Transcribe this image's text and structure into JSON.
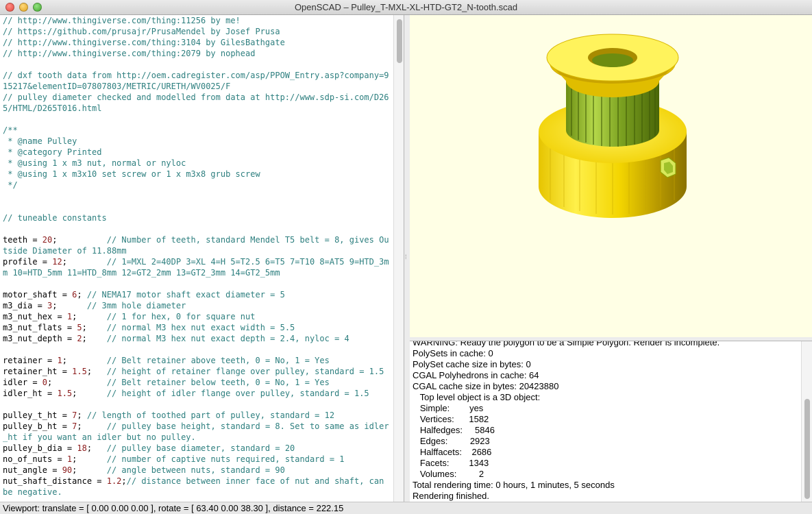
{
  "window": {
    "title": "OpenSCAD – Pulley_T-MXL-XL-HTD-GT2_N-tooth.scad",
    "controls": [
      "close-icon",
      "minimize-icon",
      "zoom-icon"
    ]
  },
  "editor": {
    "lines": [
      [
        [
          "c",
          "// http://www.thingiverse.com/thing:11256 by me!"
        ]
      ],
      [
        [
          "c",
          "// https://github.com/prusajr/PrusaMendel by Josef Prusa"
        ]
      ],
      [
        [
          "c",
          "// http://www.thingiverse.com/thing:3104 by GilesBathgate"
        ]
      ],
      [
        [
          "c",
          "// http://www.thingiverse.com/thing:2079 by nophead"
        ]
      ],
      [],
      [
        [
          "c",
          "// dxf tooth data from http://oem.cadregister.com/asp/PPOW_Entry.asp?company=9"
        ]
      ],
      [
        [
          "c",
          "15217&elementID=07807803/METRIC/URETH/WV0025/F"
        ]
      ],
      [
        [
          "c",
          "// pulley diameter checked and modelled from data at http://www.sdp-si.com/D26"
        ]
      ],
      [
        [
          "c",
          "5/HTML/D265T016.html"
        ]
      ],
      [],
      [
        [
          "c",
          "/**"
        ]
      ],
      [
        [
          "c",
          " * @name Pulley"
        ]
      ],
      [
        [
          "c",
          " * @category Printed"
        ]
      ],
      [
        [
          "c",
          " * @using 1 x m3 nut, normal or nyloc"
        ]
      ],
      [
        [
          "c",
          " * @using 1 x m3x10 set screw or 1 x m3x8 grub screw"
        ]
      ],
      [
        [
          "c",
          " */"
        ]
      ],
      [],
      [],
      [
        [
          "c",
          "// tuneable constants"
        ]
      ],
      [],
      [
        [
          "t",
          "teeth = "
        ],
        [
          "n",
          "20"
        ],
        [
          "t",
          ";          "
        ],
        [
          "c",
          "// Number of teeth, standard Mendel T5 belt = 8, gives Ou"
        ]
      ],
      [
        [
          "c",
          "tside Diameter of 11.88mm"
        ]
      ],
      [
        [
          "t",
          "profile = "
        ],
        [
          "n",
          "12"
        ],
        [
          "t",
          ";        "
        ],
        [
          "c",
          "// 1=MXL 2=40DP 3=XL 4=H 5=T2.5 6=T5 7=T10 8=AT5 9=HTD_3m"
        ]
      ],
      [
        [
          "c",
          "m 10=HTD_5mm 11=HTD_8mm 12=GT2_2mm 13=GT2_3mm 14=GT2_5mm"
        ]
      ],
      [],
      [
        [
          "t",
          "motor_shaft = "
        ],
        [
          "n",
          "6"
        ],
        [
          "t",
          "; "
        ],
        [
          "c",
          "// NEMA17 motor shaft exact diameter = 5"
        ]
      ],
      [
        [
          "t",
          "m3_dia = "
        ],
        [
          "n",
          "3"
        ],
        [
          "t",
          ";      "
        ],
        [
          "c",
          "// 3mm hole diameter"
        ]
      ],
      [
        [
          "t",
          "m3_nut_hex = "
        ],
        [
          "n",
          "1"
        ],
        [
          "t",
          ";      "
        ],
        [
          "c",
          "// 1 for hex, 0 for square nut"
        ]
      ],
      [
        [
          "t",
          "m3_nut_flats = "
        ],
        [
          "n",
          "5"
        ],
        [
          "t",
          ";    "
        ],
        [
          "c",
          "// normal M3 hex nut exact width = 5.5"
        ]
      ],
      [
        [
          "t",
          "m3_nut_depth = "
        ],
        [
          "n",
          "2"
        ],
        [
          "t",
          ";    "
        ],
        [
          "c",
          "// normal M3 hex nut exact depth = 2.4, nyloc = 4"
        ]
      ],
      [],
      [
        [
          "t",
          "retainer = "
        ],
        [
          "n",
          "1"
        ],
        [
          "t",
          ";        "
        ],
        [
          "c",
          "// Belt retainer above teeth, 0 = No, 1 = Yes"
        ]
      ],
      [
        [
          "t",
          "retainer_ht = "
        ],
        [
          "n",
          "1.5"
        ],
        [
          "t",
          ";   "
        ],
        [
          "c",
          "// height of retainer flange over pulley, standard = 1.5"
        ]
      ],
      [
        [
          "t",
          "idler = "
        ],
        [
          "n",
          "0"
        ],
        [
          "t",
          ";           "
        ],
        [
          "c",
          "// Belt retainer below teeth, 0 = No, 1 = Yes"
        ]
      ],
      [
        [
          "t",
          "idler_ht = "
        ],
        [
          "n",
          "1.5"
        ],
        [
          "t",
          ";      "
        ],
        [
          "c",
          "// height of idler flange over pulley, standard = 1.5"
        ]
      ],
      [],
      [
        [
          "t",
          "pulley_t_ht = "
        ],
        [
          "n",
          "7"
        ],
        [
          "t",
          "; "
        ],
        [
          "c",
          "// length of toothed part of pulley, standard = 12"
        ]
      ],
      [
        [
          "t",
          "pulley_b_ht = "
        ],
        [
          "n",
          "7"
        ],
        [
          "t",
          ";     "
        ],
        [
          "c",
          "// pulley base height, standard = 8. Set to same as idler"
        ]
      ],
      [
        [
          "c",
          "_ht if you want an idler but no pulley."
        ]
      ],
      [
        [
          "t",
          "pulley_b_dia = "
        ],
        [
          "n",
          "18"
        ],
        [
          "t",
          ";   "
        ],
        [
          "c",
          "// pulley base diameter, standard = 20"
        ]
      ],
      [
        [
          "t",
          "no_of_nuts = "
        ],
        [
          "n",
          "1"
        ],
        [
          "t",
          ";      "
        ],
        [
          "c",
          "// number of captive nuts required, standard = 1"
        ]
      ],
      [
        [
          "t",
          "nut_angle = "
        ],
        [
          "n",
          "90"
        ],
        [
          "t",
          ";      "
        ],
        [
          "c",
          "// angle between nuts, standard = 90"
        ]
      ],
      [
        [
          "t",
          "nut_shaft_distance = "
        ],
        [
          "n",
          "1.2"
        ],
        [
          "t",
          ";"
        ],
        [
          "c",
          "// distance between inner face of nut and shaft, can"
        ]
      ],
      [
        [
          "c",
          "be negative."
        ]
      ]
    ]
  },
  "console": {
    "lines": [
      "WARNING: Ready the polygon to be a Simple Polygon. Render is incomplete.",
      "PolySets in cache: 0",
      "PolySet cache size in bytes: 0",
      "CGAL Polyhedrons in cache: 64",
      "CGAL cache size in bytes: 20423880",
      "   Top level object is a 3D object:",
      "   Simple:        yes",
      "   Vertices:      1582",
      "   Halfedges:     5846",
      "   Edges:         2923",
      "   Halffacets:    2686",
      "   Facets:        1343",
      "   Volumes:         2",
      "Total rendering time: 0 hours, 1 minutes, 5 seconds",
      "Rendering finished."
    ]
  },
  "status": {
    "viewport": "Viewport: translate = [ 0.00 0.00 0.00 ], rotate = [ 63.40 0.00 38.30 ], distance = 222.15"
  },
  "colors": {
    "viewport_bg": "#ffffe5",
    "model_yellow": "#f5d800",
    "model_green": "#8fbf2a",
    "comment": "#2d7f7f",
    "number": "#8b1a1a"
  }
}
